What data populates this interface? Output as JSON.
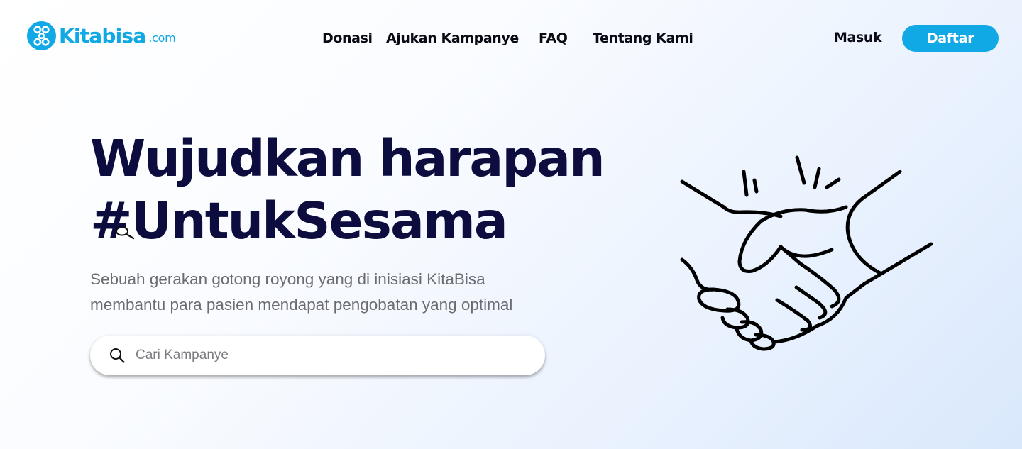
{
  "brand": {
    "name": "Kitabisa",
    "domain": ".com",
    "color": "#10a8e5"
  },
  "nav": {
    "items": [
      {
        "label": "Donasi"
      },
      {
        "label": "Ajukan Kampanye"
      },
      {
        "label": "FAQ"
      },
      {
        "label": "Tentang Kami"
      }
    ]
  },
  "auth": {
    "login_label": "Masuk",
    "register_label": "Daftar"
  },
  "hero": {
    "title_line1": "Wujudkan harapan",
    "title_line2": "#UntukSesama",
    "subtitle_line1": "Sebuah gerakan gotong royong yang di inisiasi KitaBisa",
    "subtitle_line2": "membantu para pasien mendapat pengobatan yang optimal",
    "title_color": "#0c0c3e"
  },
  "search": {
    "placeholder": "Cari Kampanye",
    "value": "",
    "icon": "search-icon"
  },
  "illustration": {
    "icon": "handshake-icon"
  }
}
